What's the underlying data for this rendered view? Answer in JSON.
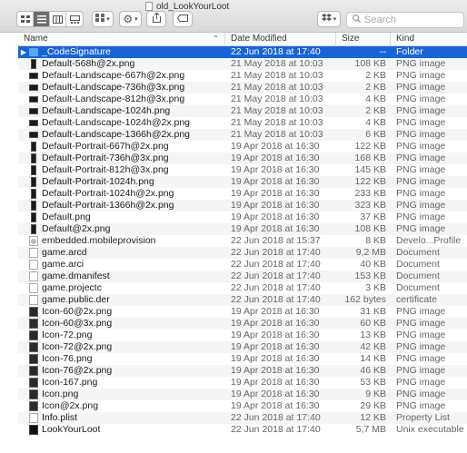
{
  "window": {
    "title": "old_LookYourLoot"
  },
  "search": {
    "placeholder": "Search"
  },
  "toolbar": {
    "view_icons": [
      "icon-view-icon",
      "list-view-icon",
      "column-view-icon",
      "gallery-view-icon"
    ],
    "arrange_icon": "arrange-grid-icon",
    "action_icon": "gear-icon",
    "share_icon": "share-icon",
    "tag_icon": "tag-icon",
    "dropbox_icon": "dropbox-icon"
  },
  "columns": {
    "name": "Name",
    "date": "Date Modified",
    "size": "Size",
    "kind": "Kind"
  },
  "colors": {
    "selection": "#1665d8",
    "folder": "#59a6f0",
    "alt_row": "#f4f5f5"
  },
  "files": [
    {
      "name": "_CodeSignature",
      "date": "22 Jun 2018 at 17:40",
      "size": "--",
      "kind": "Folder",
      "icon": "folder",
      "selected": true
    },
    {
      "name": "Default-568h@2x.png",
      "date": "21 May 2018 at 10:03",
      "size": "108 KB",
      "kind": "PNG image",
      "icon": "img-portrait"
    },
    {
      "name": "Default-Landscape-667h@2x.png",
      "date": "21 May 2018 at 10:03",
      "size": "2 KB",
      "kind": "PNG image",
      "icon": "img-land"
    },
    {
      "name": "Default-Landscape-736h@3x.png",
      "date": "21 May 2018 at 10:03",
      "size": "2 KB",
      "kind": "PNG image",
      "icon": "img-land"
    },
    {
      "name": "Default-Landscape-812h@3x.png",
      "date": "21 May 2018 at 10:03",
      "size": "4 KB",
      "kind": "PNG image",
      "icon": "img-land"
    },
    {
      "name": "Default-Landscape-1024h.png",
      "date": "21 May 2018 at 10:03",
      "size": "2 KB",
      "kind": "PNG image",
      "icon": "img-land"
    },
    {
      "name": "Default-Landscape-1024h@2x.png",
      "date": "21 May 2018 at 10:03",
      "size": "4 KB",
      "kind": "PNG image",
      "icon": "img-land"
    },
    {
      "name": "Default-Landscape-1366h@2x.png",
      "date": "21 May 2018 at 10:03",
      "size": "6 KB",
      "kind": "PNG image",
      "icon": "img-land"
    },
    {
      "name": "Default-Portrait-667h@2x.png",
      "date": "19 Apr 2018 at 16:30",
      "size": "122 KB",
      "kind": "PNG image",
      "icon": "img-portrait"
    },
    {
      "name": "Default-Portrait-736h@3x.png",
      "date": "19 Apr 2018 at 16:30",
      "size": "168 KB",
      "kind": "PNG image",
      "icon": "img-portrait"
    },
    {
      "name": "Default-Portrait-812h@3x.png",
      "date": "19 Apr 2018 at 16:30",
      "size": "145 KB",
      "kind": "PNG image",
      "icon": "img-portrait"
    },
    {
      "name": "Default-Portrait-1024h.png",
      "date": "19 Apr 2018 at 16:30",
      "size": "122 KB",
      "kind": "PNG image",
      "icon": "img-portrait"
    },
    {
      "name": "Default-Portrait-1024h@2x.png",
      "date": "19 Apr 2018 at 16:30",
      "size": "233 KB",
      "kind": "PNG image",
      "icon": "img-portrait"
    },
    {
      "name": "Default-Portrait-1366h@2x.png",
      "date": "19 Apr 2018 at 16:30",
      "size": "323 KB",
      "kind": "PNG image",
      "icon": "img-portrait"
    },
    {
      "name": "Default.png",
      "date": "19 Apr 2018 at 16:30",
      "size": "37 KB",
      "kind": "PNG image",
      "icon": "img-portrait"
    },
    {
      "name": "Default@2x.png",
      "date": "19 Apr 2018 at 16:30",
      "size": "108 KB",
      "kind": "PNG image",
      "icon": "img-portrait"
    },
    {
      "name": "embedded.mobileprovision",
      "date": "22 Jun 2018 at 15:37",
      "size": "8 KB",
      "kind": "Develo...Profile",
      "icon": "prov"
    },
    {
      "name": "game.arcd",
      "date": "22 Jun 2018 at 17:40",
      "size": "9,2 MB",
      "kind": "Document",
      "icon": "doc"
    },
    {
      "name": "game.arci",
      "date": "22 Jun 2018 at 17:40",
      "size": "40 KB",
      "kind": "Document",
      "icon": "doc"
    },
    {
      "name": "game.dmanifest",
      "date": "22 Jun 2018 at 17:40",
      "size": "153 KB",
      "kind": "Document",
      "icon": "doc"
    },
    {
      "name": "game.projectc",
      "date": "22 Jun 2018 at 17:40",
      "size": "3 KB",
      "kind": "Document",
      "icon": "doc"
    },
    {
      "name": "game.public.der",
      "date": "22 Jun 2018 at 17:40",
      "size": "162 bytes",
      "kind": "certificate",
      "icon": "doc"
    },
    {
      "name": "Icon-60@2x.png",
      "date": "19 Apr 2018 at 16:30",
      "size": "31 KB",
      "kind": "PNG image",
      "icon": "img-square"
    },
    {
      "name": "Icon-60@3x.png",
      "date": "19 Apr 2018 at 16:30",
      "size": "60 KB",
      "kind": "PNG image",
      "icon": "img-square"
    },
    {
      "name": "Icon-72.png",
      "date": "19 Apr 2018 at 16:30",
      "size": "13 KB",
      "kind": "PNG image",
      "icon": "img-square"
    },
    {
      "name": "Icon-72@2x.png",
      "date": "19 Apr 2018 at 16:30",
      "size": "42 KB",
      "kind": "PNG image",
      "icon": "img-square"
    },
    {
      "name": "Icon-76.png",
      "date": "19 Apr 2018 at 16:30",
      "size": "14 KB",
      "kind": "PNG image",
      "icon": "img-square"
    },
    {
      "name": "Icon-76@2x.png",
      "date": "19 Apr 2018 at 16:30",
      "size": "46 KB",
      "kind": "PNG image",
      "icon": "img-square"
    },
    {
      "name": "Icon-167.png",
      "date": "19 Apr 2018 at 16:30",
      "size": "53 KB",
      "kind": "PNG image",
      "icon": "img-square"
    },
    {
      "name": "Icon.png",
      "date": "19 Apr 2018 at 16:30",
      "size": "9 KB",
      "kind": "PNG image",
      "icon": "img-square"
    },
    {
      "name": "Icon@2x.png",
      "date": "19 Apr 2018 at 16:30",
      "size": "29 KB",
      "kind": "PNG image",
      "icon": "img-square"
    },
    {
      "name": "Info.plist",
      "date": "22 Jun 2018 at 17:40",
      "size": "12 KB",
      "kind": "Property List",
      "icon": "doc"
    },
    {
      "name": "LookYourLoot",
      "date": "22 Jun 2018 at 17:40",
      "size": "5,7 MB",
      "kind": "Unix executable",
      "icon": "exec"
    }
  ]
}
